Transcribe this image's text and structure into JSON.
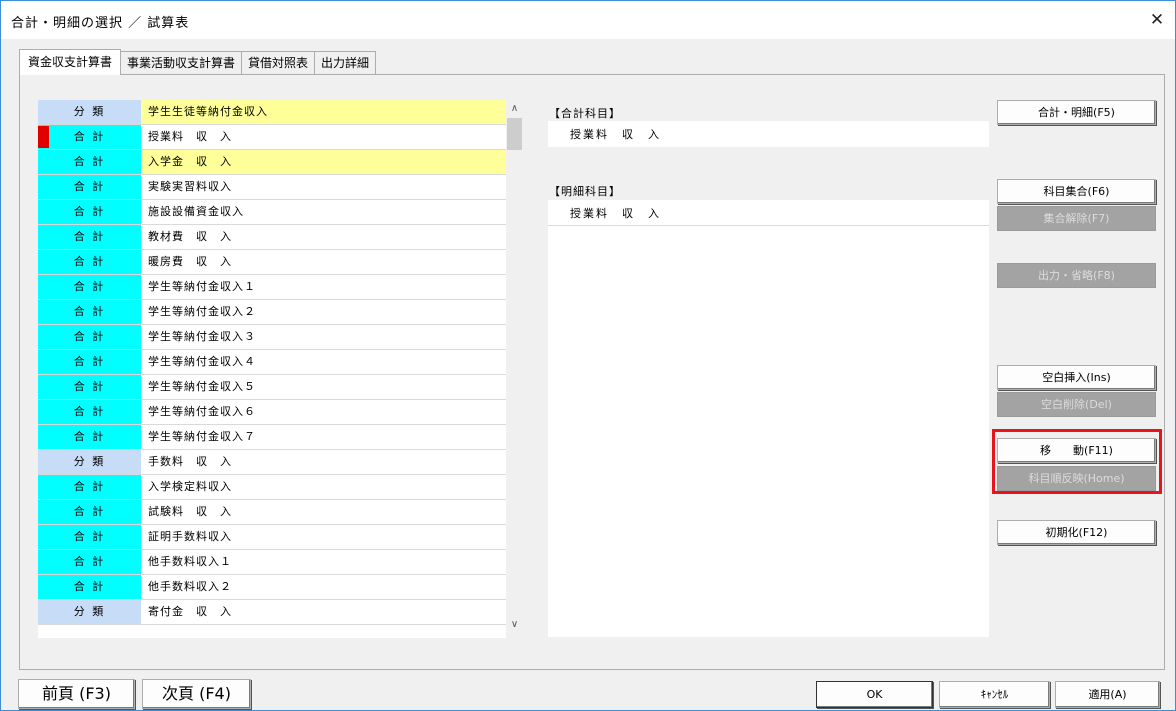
{
  "window": {
    "title": "合計・明細の選択 ／ 試算表",
    "close_icon": "close-icon"
  },
  "tabs": [
    {
      "label": "資金収支計算書",
      "active": true
    },
    {
      "label": "事業活動収支計算書",
      "active": false
    },
    {
      "label": "貸借対照表",
      "active": false
    },
    {
      "label": "出力詳細",
      "active": false
    }
  ],
  "grid": {
    "rows": [
      {
        "category": "分 類",
        "name": "学生生徒等納付金収入",
        "kind": "bunrui",
        "highlight": true,
        "marker": false
      },
      {
        "category": "合 計",
        "name": "授業料　収　入",
        "kind": "goukei",
        "highlight": false,
        "marker": true
      },
      {
        "category": "合 計",
        "name": "入学金　収　入",
        "kind": "goukei",
        "highlight": true,
        "marker": false
      },
      {
        "category": "合 計",
        "name": "実験実習料収入",
        "kind": "goukei",
        "highlight": false,
        "marker": false
      },
      {
        "category": "合 計",
        "name": "施設設備資金収入",
        "kind": "goukei",
        "highlight": false,
        "marker": false
      },
      {
        "category": "合 計",
        "name": "教材費　収　入",
        "kind": "goukei",
        "highlight": false,
        "marker": false
      },
      {
        "category": "合 計",
        "name": "暖房費　収　入",
        "kind": "goukei",
        "highlight": false,
        "marker": false
      },
      {
        "category": "合 計",
        "name": "学生等納付金収入１",
        "kind": "goukei",
        "highlight": false,
        "marker": false
      },
      {
        "category": "合 計",
        "name": "学生等納付金収入２",
        "kind": "goukei",
        "highlight": false,
        "marker": false
      },
      {
        "category": "合 計",
        "name": "学生等納付金収入３",
        "kind": "goukei",
        "highlight": false,
        "marker": false
      },
      {
        "category": "合 計",
        "name": "学生等納付金収入４",
        "kind": "goukei",
        "highlight": false,
        "marker": false
      },
      {
        "category": "合 計",
        "name": "学生等納付金収入５",
        "kind": "goukei",
        "highlight": false,
        "marker": false
      },
      {
        "category": "合 計",
        "name": "学生等納付金収入６",
        "kind": "goukei",
        "highlight": false,
        "marker": false
      },
      {
        "category": "合 計",
        "name": "学生等納付金収入７",
        "kind": "goukei",
        "highlight": false,
        "marker": false
      },
      {
        "category": "分 類",
        "name": "手数料　収　入",
        "kind": "bunrui",
        "highlight": false,
        "marker": false
      },
      {
        "category": "合 計",
        "name": "入学検定料収入",
        "kind": "goukei",
        "highlight": false,
        "marker": false
      },
      {
        "category": "合 計",
        "name": "試験料　収　入",
        "kind": "goukei",
        "highlight": false,
        "marker": false
      },
      {
        "category": "合 計",
        "name": "証明手数料収入",
        "kind": "goukei",
        "highlight": false,
        "marker": false
      },
      {
        "category": "合 計",
        "name": "他手数料収入１",
        "kind": "goukei",
        "highlight": false,
        "marker": false
      },
      {
        "category": "合 計",
        "name": "他手数料収入２",
        "kind": "goukei",
        "highlight": false,
        "marker": false
      },
      {
        "category": "分 類",
        "name": "寄付金　収　入",
        "kind": "bunrui",
        "highlight": false,
        "marker": false
      }
    ]
  },
  "summary": {
    "goukei_label": "【合計科目】",
    "goukei_value": "授業料　収　入",
    "meisai_label": "【明細科目】",
    "meisai_value": "授業料　収　入"
  },
  "buttons": {
    "goukei_meisai": "合計・明細(F5)",
    "kamoku_shugo": "科目集合(F6)",
    "shugo_kaijo": "集合解除(F7)",
    "shutsuryoku_shoryaku": "出力・省略(F8)",
    "kuhaku_sonyu": "空白挿入(Ins)",
    "kuhaku_sakujo": "空白削除(Del)",
    "ido": "移　　動(F11)",
    "kamoku_jun": "科目順反映(Home)",
    "shokika": "初期化(F12)"
  },
  "footer": {
    "prev_page": "前頁 (F3)",
    "next_page": "次頁 (F4)",
    "ok": "OK",
    "cancel": "ｷｬﾝｾﾙ",
    "apply": "適用(A)"
  },
  "colors": {
    "goukei_cell": "#00ffff",
    "bunrui_cell": "#c7dcf7",
    "highlight_row": "#ffff99",
    "marker": "#e00000",
    "focus_box": "#e8141c",
    "disabled_button": "#a3a3a3"
  }
}
